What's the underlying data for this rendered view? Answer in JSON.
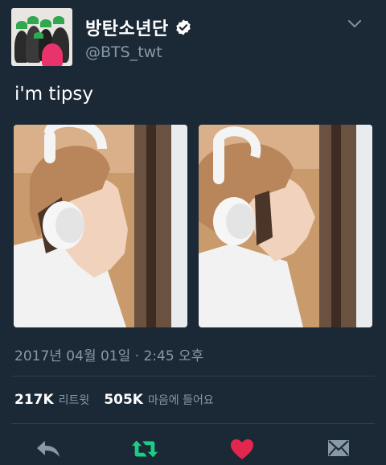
{
  "user": {
    "display_name": "방탄소년단",
    "handle": "@BTS_twt",
    "verified": true
  },
  "tweet": {
    "text": "i'm tipsy",
    "timestamp": "2017년 04월 01일 · 2:45 오후"
  },
  "stats": {
    "retweets_count": "217K",
    "retweets_label": "리트윗",
    "likes_count": "505K",
    "likes_label": "마음에 들어요"
  },
  "icons": {
    "verified": "verified-badge-icon",
    "menu": "chevron-down-icon",
    "reply": "reply-icon",
    "retweet": "retweet-icon",
    "like": "heart-icon",
    "message": "direct-message-icon"
  },
  "colors": {
    "background": "#1b2836",
    "secondary_text": "#8899a6",
    "retweet_active": "#19cf86",
    "like_active": "#e2264d"
  }
}
